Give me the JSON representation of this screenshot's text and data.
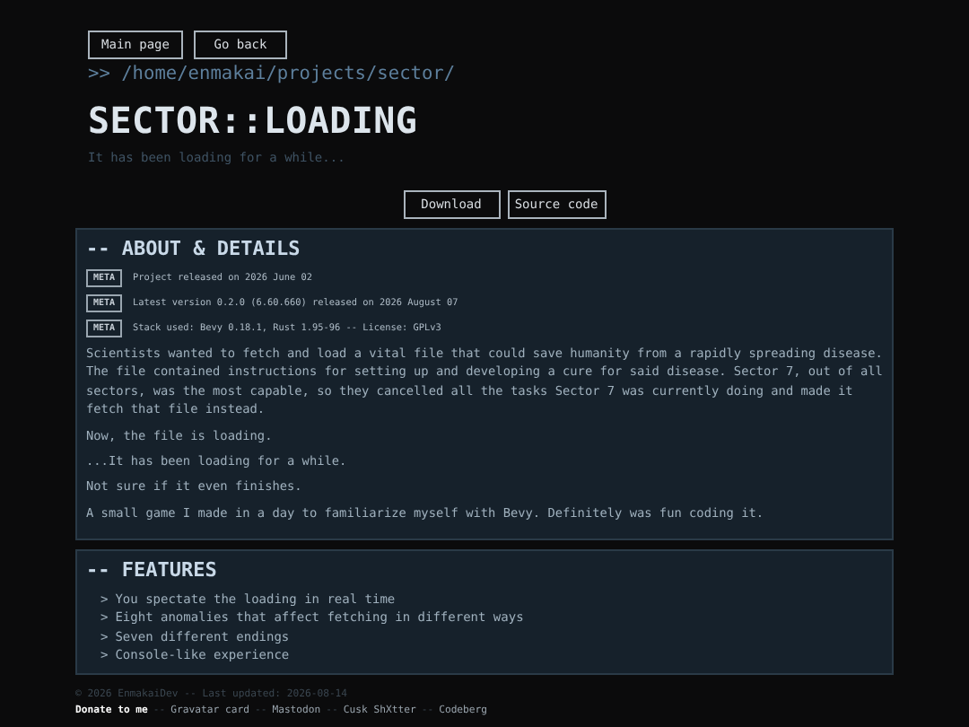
{
  "nav_buttons": [
    "Main page",
    "Go back"
  ],
  "path": ">> /home/enmakai/projects/sector/",
  "title": "SECTOR::LOADING",
  "subtitle": "It has been loading for a while...",
  "action_buttons": [
    "Download",
    "Source code"
  ],
  "about": {
    "heading": "-- ABOUT & DETAILS",
    "meta": [
      {
        "tag": "META",
        "text": "Project released on 2026 June 02"
      },
      {
        "tag": "META",
        "text": "Latest version 0.2.0 (6.60.660) released on 2026 August 07"
      },
      {
        "tag": "META",
        "text": "Stack used: Bevy 0.18.1, Rust 1.95-96 -- License: GPLv3"
      }
    ],
    "paragraphs": [
      "Scientists wanted to fetch and load a vital file that could save humanity from a rapidly spreading disease. The file contained instructions for setting up and developing a cure for said disease. Sector 7, out of all sectors, was the most capable, so they cancelled all the tasks Sector 7 was currently doing and made it fetch that file instead.",
      "Now, the file is loading.",
      "...It has been loading for a while.",
      "Not sure if it even finishes.",
      "A small game I made in a day to familiarize myself with Bevy. Definitely was fun coding it."
    ]
  },
  "features": {
    "heading": "-- FEATURES",
    "bullet": ">",
    "items": [
      "You spectate the loading in real time",
      "Eight anomalies that affect fetching in different ways",
      "Seven different endings",
      "Console-like experience"
    ]
  },
  "footer": {
    "copyright": "© 2026 EnmakaiDev -- Last updated: 2026-08-14",
    "separator": "--",
    "links": [
      {
        "label": "Donate to me",
        "selected": true
      },
      {
        "label": "Gravatar card",
        "selected": false
      },
      {
        "label": "Mastodon",
        "selected": false
      },
      {
        "label": "Cusk ShXtter",
        "selected": false
      },
      {
        "label": "Codeberg",
        "selected": false
      }
    ]
  }
}
